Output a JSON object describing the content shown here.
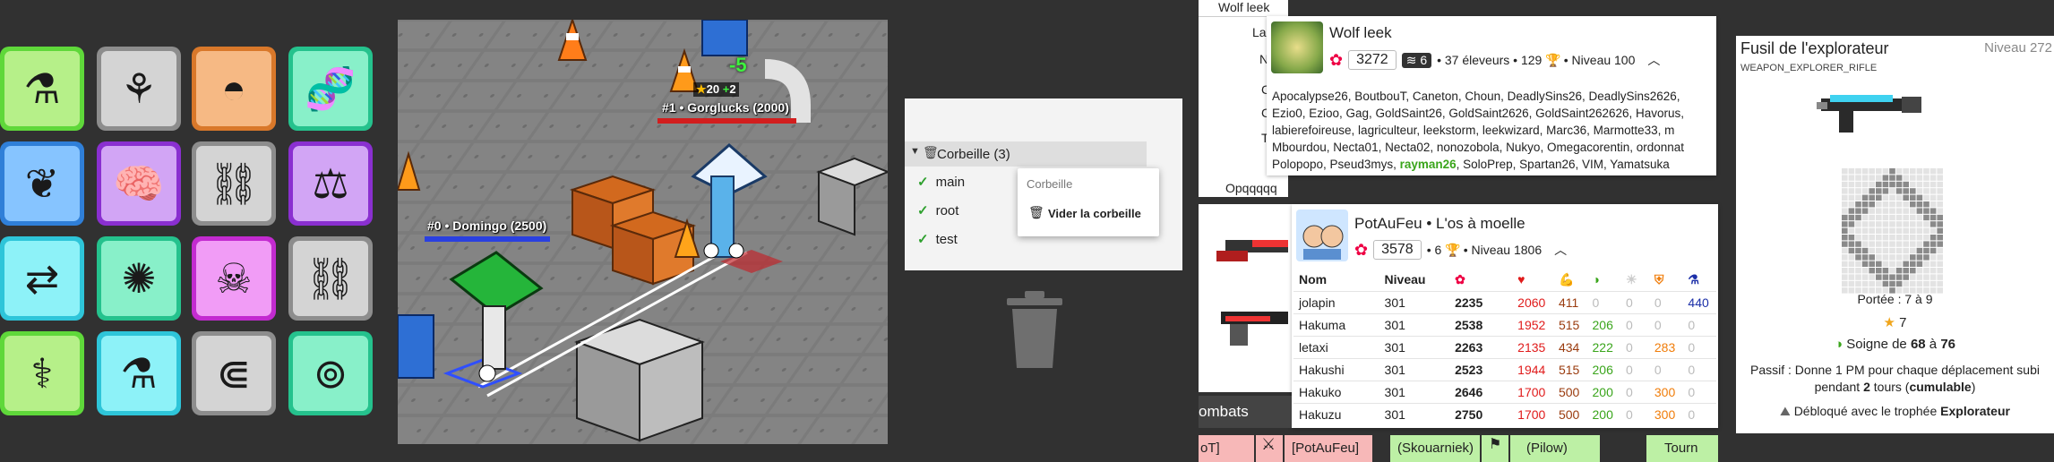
{
  "chips_grid": [
    {
      "icon": "battery-potion-icon",
      "color": "green"
    },
    {
      "icon": "plant-pot-icon",
      "color": "grey"
    },
    {
      "icon": "helmet-icon",
      "color": "orange"
    },
    {
      "icon": "dna-icon",
      "color": "teal"
    },
    {
      "icon": "thorn-icon",
      "color": "blue"
    },
    {
      "icon": "brain-icon",
      "color": "purple"
    },
    {
      "icon": "broken-chain-icon",
      "color": "grey"
    },
    {
      "icon": "weight-icon",
      "color": "purple"
    },
    {
      "icon": "arrows-potion-icon",
      "color": "cyan"
    },
    {
      "icon": "leaf-burst-icon",
      "color": "teal"
    },
    {
      "icon": "skull-crossbones-icon",
      "color": "magenta"
    },
    {
      "icon": "chain-link-icon",
      "color": "grey"
    },
    {
      "icon": "caduceus-icon",
      "color": "green"
    },
    {
      "icon": "flask-potion-icon",
      "color": "cyan"
    },
    {
      "icon": "chain-e-icon",
      "color": "grey"
    },
    {
      "icon": "shield-ring-icon",
      "color": "teal"
    }
  ],
  "fight": {
    "entity1": {
      "label": "#1 • Gorglucks (2000)"
    },
    "entity0": {
      "label": "#0 • Domingo (2500)"
    },
    "damage": "-5",
    "buff_left": "20",
    "buff_right": "2"
  },
  "trash": {
    "folder_label": "Corbeille (3)",
    "items": [
      "main",
      "root",
      "test"
    ],
    "menu_title": "Corbeille",
    "menu_action": "Vider la corbeille"
  },
  "bg_table": {
    "header_name": "Wolf leek",
    "row_labels": [
      "La",
      "N",
      "C",
      "C",
      "T"
    ],
    "bottom_text": "Opqqqqq"
  },
  "wolf_panel": {
    "name": "Wolf leek",
    "talent": "3272",
    "rank": "6",
    "meta": "• 37 éleveurs • 129",
    "level": "• Niveau 100",
    "members_before": "Apocalypse26, BoutbouT, Caneton, Choun, DeadlySins26, DeadlySins2626, Ezio0, Ezioo, Gag, GoldSaint26, GoldSaint2626, GoldSaint262626, Havorus, labierefoireuse, lagriculteur, leekstorm, leekwizard, Marc36, Marmotte33, m Mbourdou, Necta01, Necta02, nonozobola, Nukyo, Omegacorentin, ordonnat Polopopo, Pseud3mys, ",
    "members_highlight": "rayman26",
    "members_after": ", SoloPrep, Spartan26, VIM, Yamatsuka"
  },
  "potaufeu_panel": {
    "name": "PotAuFeu • L'os à moelle",
    "talent": "3578",
    "meta": "• 6",
    "level": "• Niveau 1806",
    "columns": [
      "Nom",
      "Niveau"
    ],
    "rows": [
      {
        "name": "jolapin",
        "level": "301",
        "talent": "2235",
        "life": "2060",
        "strength": "411",
        "wisdom": "0",
        "agility": "0",
        "resistance": "0",
        "magic": "440"
      },
      {
        "name": "Hakuma",
        "level": "301",
        "talent": "2538",
        "life": "1952",
        "strength": "515",
        "wisdom": "206",
        "agility": "0",
        "resistance": "0",
        "magic": "0"
      },
      {
        "name": "letaxi",
        "level": "301",
        "talent": "2263",
        "life": "2135",
        "strength": "434",
        "wisdom": "222",
        "agility": "0",
        "resistance": "283",
        "magic": "0"
      },
      {
        "name": "Hakushi",
        "level": "301",
        "talent": "2523",
        "life": "1944",
        "strength": "515",
        "wisdom": "206",
        "agility": "0",
        "resistance": "0",
        "magic": "0"
      },
      {
        "name": "Hakuko",
        "level": "301",
        "talent": "2646",
        "life": "1700",
        "strength": "500",
        "wisdom": "200",
        "agility": "0",
        "resistance": "300",
        "magic": "0"
      },
      {
        "name": "Hakuzu",
        "level": "301",
        "talent": "2750",
        "life": "1700",
        "strength": "500",
        "wisdom": "200",
        "agility": "0",
        "resistance": "300",
        "magic": "0"
      }
    ]
  },
  "fights_bar": {
    "title": "ombats",
    "cells": [
      "oT]",
      "[PotAuFeu]",
      "(Skouarniek)",
      "(Pilow)",
      "Tourn"
    ]
  },
  "weapon_panel": {
    "name": "Fusil de l'explorateur",
    "level": "Niveau 272",
    "code": "WEAPON_EXPLORER_RIFLE",
    "range": "Portée : 7 à 9",
    "cost": "7",
    "heal_prefix": "Soigne de ",
    "heal_min": "68",
    "heal_mid": " à ",
    "heal_max": "76",
    "passive_1": "Passif : Donne 1 PM pour chaque déplacement subi",
    "passive_2a": "pendant ",
    "passive_2b": "2",
    "passive_2c": " tours (",
    "passive_2d": "cumulable",
    "passive_2e": ")",
    "unlock_prefix": "Débloqué avec le trophée ",
    "unlock_trophy": "Explorateur"
  },
  "colors": {
    "background": "#313131",
    "talent_life": "#e01b1b",
    "strength": "#9a3b0e",
    "wisdom": "#3aa51b",
    "resistance": "#f07d0a",
    "magic": "#1b2fa8",
    "highlight_member": "#3aa51b"
  }
}
